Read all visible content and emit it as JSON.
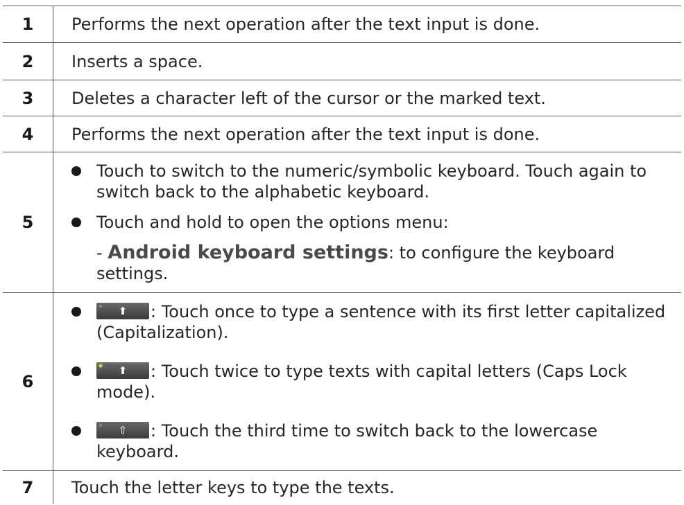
{
  "rows": [
    {
      "num": "1",
      "text": "Performs the next operation after the text input is done."
    },
    {
      "num": "2",
      "text": "Inserts a space."
    },
    {
      "num": "3",
      "text": "Deletes a character left of the cursor or the marked text."
    },
    {
      "num": "4",
      "text": "Performs the next operation after the text input is done."
    },
    {
      "num": "5",
      "bullets": [
        "Touch to switch to the numeric/symbolic keyboard. Touch again to switch back to the alphabetic keyboard.",
        "Touch and hold to open the options menu:"
      ],
      "sub_prefix": "- ",
      "sub_bold": "Android keyboard settings",
      "sub_rest": ": to configure the keyboard settings."
    },
    {
      "num": "6",
      "bullets": [
        ": Touch once to type a sentence with its first letter capitalized (Capitalization).",
        ": Touch twice to type texts with capital letters (Caps Lock mode).",
        ": Touch the third time to switch back to the lowercase keyboard."
      ],
      "key_icons": [
        "shift-filled-icon",
        "shift-locked-icon",
        "shift-outline-icon"
      ],
      "key_glyphs": [
        "⬆",
        "⬆",
        "⇧"
      ]
    },
    {
      "num": "7",
      "text": "Touch the letter keys to type the texts."
    }
  ]
}
